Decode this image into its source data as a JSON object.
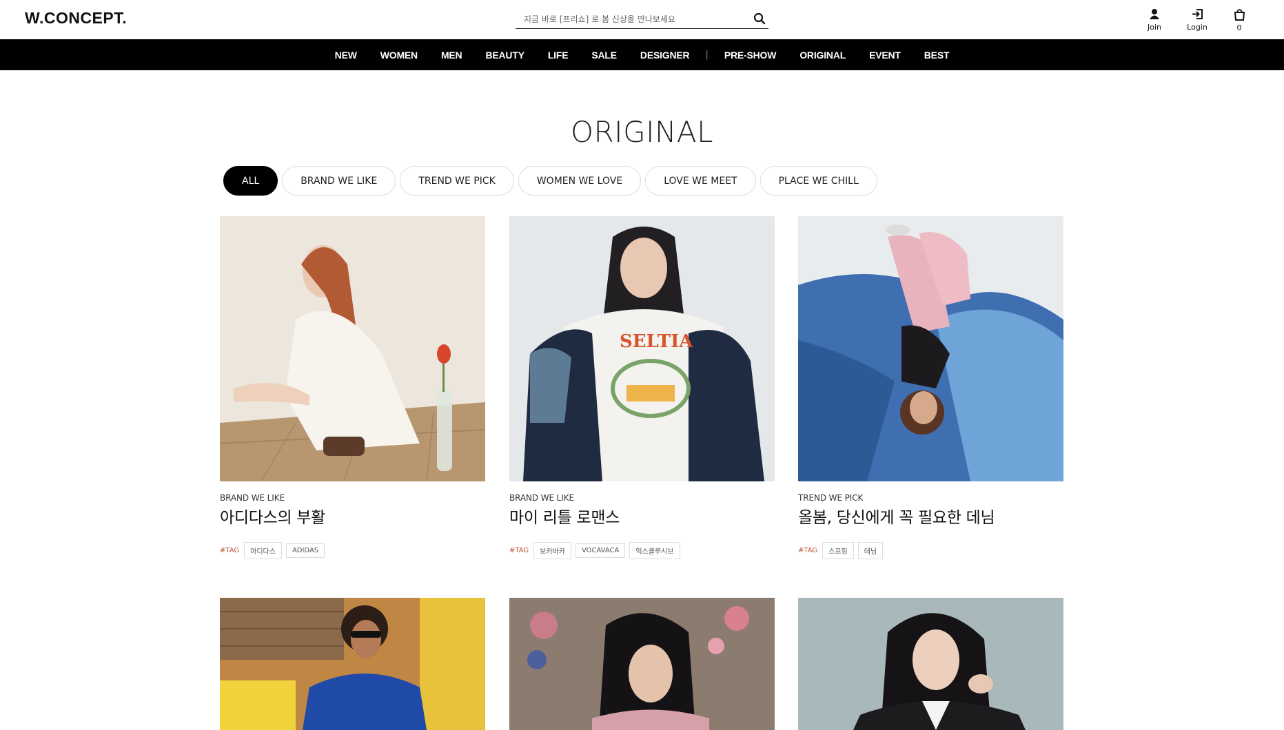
{
  "header": {
    "logo": "W.CONCEPT.",
    "search_placeholder": "지금 바로 [프리쇼] 로 봄 신상을 만나보세요",
    "join_label": "Join",
    "login_label": "Login",
    "cart_count": "0"
  },
  "nav": {
    "items": [
      "NEW",
      "WOMEN",
      "MEN",
      "BEAUTY",
      "LIFE",
      "SALE",
      "DESIGNER",
      "PRE-SHOW",
      "ORIGINAL",
      "EVENT",
      "BEST"
    ],
    "separator": "|"
  },
  "page_title": "ORIGINAL",
  "filters": [
    "ALL",
    "BRAND WE LIKE",
    "TREND WE PICK",
    "WOMEN WE LOVE",
    "LOVE WE MEET",
    "PLACE WE CHILL"
  ],
  "active_filter": "ALL",
  "tag_label": "#TAG",
  "cards": [
    {
      "category": "BRAND WE LIKE",
      "title": "아디다스의 부활",
      "tags": [
        "아디다스",
        "ADIDAS"
      ]
    },
    {
      "category": "BRAND WE LIKE",
      "title": "마이 리틀 로맨스",
      "tags": [
        "보카바카",
        "VOCAVACA",
        "익스클루시브"
      ]
    },
    {
      "category": "TREND WE PICK",
      "title": "올봄, 당신에게 꼭 필요한 데님",
      "tags": [
        "스프링",
        "데님"
      ]
    },
    {
      "category": "",
      "title": "",
      "tags": []
    },
    {
      "category": "",
      "title": "",
      "tags": []
    },
    {
      "category": "",
      "title": "",
      "tags": []
    }
  ],
  "colors": {
    "navbar_bg": "#000000",
    "tag_accent": "#c0563a",
    "active_filter_bg": "#000000"
  }
}
